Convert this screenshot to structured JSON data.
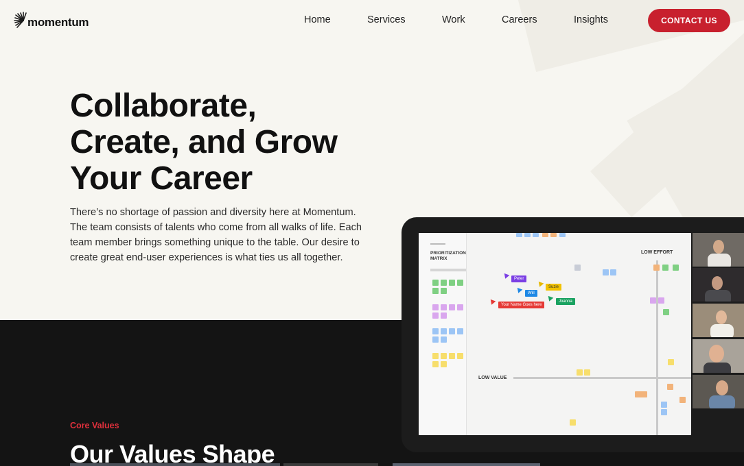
{
  "header": {
    "logo_text": "momentum",
    "nav": [
      "Home",
      "Services",
      "Work",
      "Careers",
      "Insights"
    ],
    "cta_label": "CONTACT US"
  },
  "hero": {
    "title_lines": [
      "Collaborate,",
      "Create, and Grow",
      "Your Career"
    ],
    "description": "There’s no shortage of passion and diversity here at Momentum. The team consists of talents who come from all walks of life. Each team member brings something unique to the table. Our desire to create great end-user experiences is what ties us all together."
  },
  "mockup": {
    "panel_title": "PRIORITIZATION MATRIX",
    "low_effort": "LOW EFFORT",
    "low_value": "LOW VALUE",
    "cursors": [
      "Peter",
      "Suzie",
      "Will",
      "Joanna",
      "Your Name Goes here"
    ]
  },
  "values": {
    "label": "Core Values",
    "title": "Our Values Shape"
  },
  "colors": {
    "accent": "#c8202e",
    "background": "#f7f6f1",
    "dark": "#141414"
  }
}
